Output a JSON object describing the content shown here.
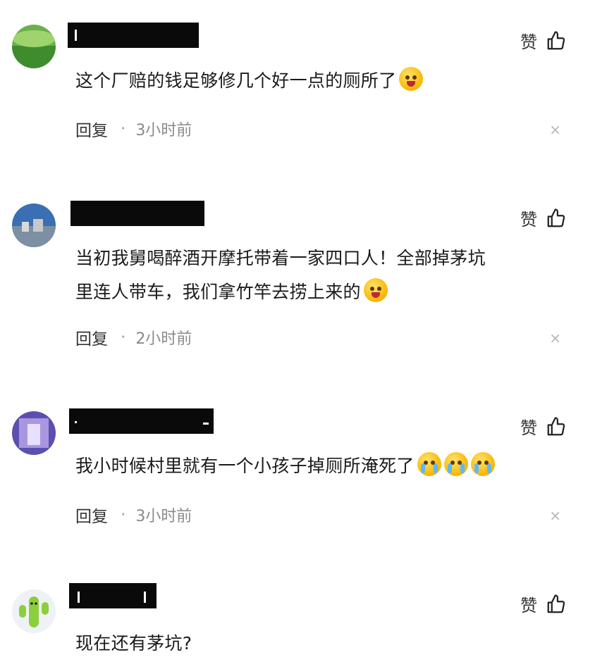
{
  "comments": [
    {
      "text": "这个厂赔的钱足够修几个好一点的厕所了",
      "like_label": "赞",
      "reply_label": "回复",
      "time": "3小时前",
      "emojis": [
        "laughing-crying"
      ]
    },
    {
      "text_lines": [
        "当初我舅喝醉酒开摩托带着一家四口人！全部掉茅坑",
        "里连人带车，我们拿竹竿去捞上来的"
      ],
      "like_label": "赞",
      "reply_label": "回复",
      "time": "2小时前",
      "emojis": [
        "rolling-laughing"
      ]
    },
    {
      "text": "我小时候村里就有一个小孩子掉厕所淹死了",
      "like_label": "赞",
      "reply_label": "回复",
      "time": "3小时前",
      "emojis": [
        "crying",
        "crying",
        "crying"
      ]
    },
    {
      "text": "现在还有茅坑?",
      "like_label": "赞"
    }
  ],
  "dot": "·",
  "close_glyph": "×"
}
